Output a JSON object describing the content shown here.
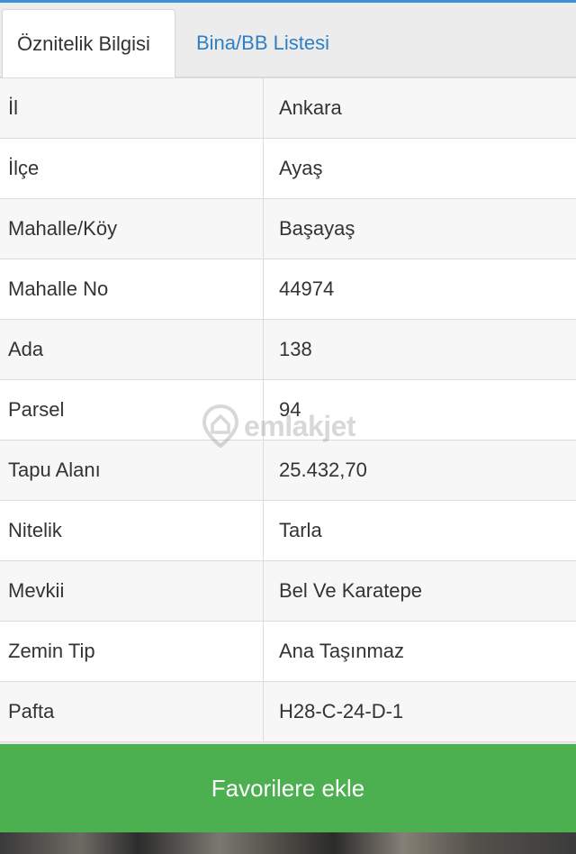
{
  "tabs": [
    {
      "label": "Öznitelik Bilgisi",
      "active": true
    },
    {
      "label": "Bina/BB Listesi",
      "active": false
    }
  ],
  "rows": [
    {
      "label": "İl",
      "value": "Ankara"
    },
    {
      "label": "İlçe",
      "value": "Ayaş"
    },
    {
      "label": "Mahalle/Köy",
      "value": "Başayaş"
    },
    {
      "label": "Mahalle No",
      "value": "44974"
    },
    {
      "label": "Ada",
      "value": "138"
    },
    {
      "label": "Parsel",
      "value": "94"
    },
    {
      "label": "Tapu Alanı",
      "value": "25.432,70"
    },
    {
      "label": "Nitelik",
      "value": "Tarla"
    },
    {
      "label": "Mevkii",
      "value": "Bel Ve Karatepe"
    },
    {
      "label": "Zemin Tip",
      "value": "Ana Taşınmaz"
    },
    {
      "label": "Pafta",
      "value": "H28-C-24-D-1"
    }
  ],
  "watermark": {
    "text": "emlakjet",
    "icon": "location-pin-house-icon"
  },
  "favorite_button": {
    "label": "Favorilere ekle"
  },
  "colors": {
    "accent_blue": "#2f7fc6",
    "button_green": "#4caf50",
    "top_border": "#3f8fd6"
  }
}
